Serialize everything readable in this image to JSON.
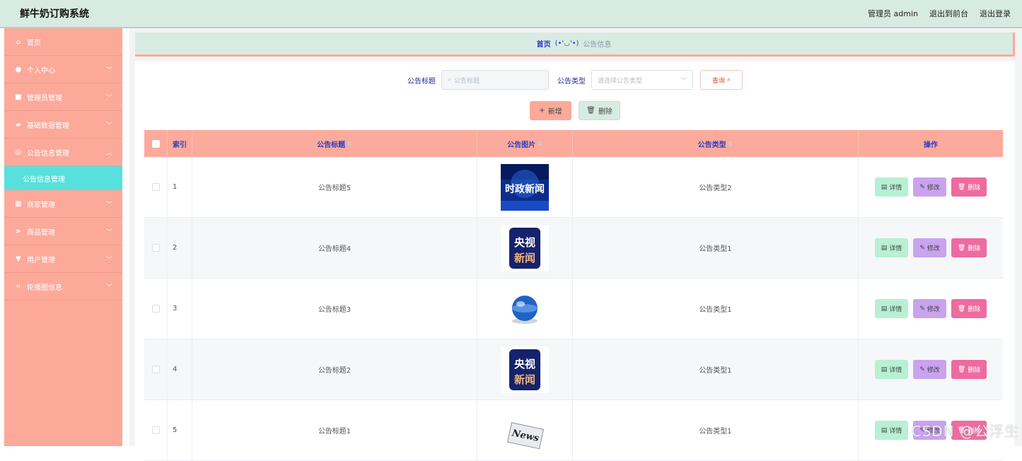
{
  "app": {
    "title": "鲜牛奶订购系统"
  },
  "top_actions": {
    "user": "管理员 admin",
    "front": "退出到前台",
    "logout": "退出登录"
  },
  "sidebar": {
    "items": [
      {
        "label": "首页",
        "icon": "home-icon"
      },
      {
        "label": "个人中心",
        "icon": "user-icon"
      },
      {
        "label": "管理员管理",
        "icon": "admin-icon"
      },
      {
        "label": "基础数据管理",
        "icon": "data-icon"
      },
      {
        "label": "公告信息管理",
        "icon": "notice-icon"
      },
      {
        "label": "商家管理",
        "icon": "grid-icon"
      },
      {
        "label": "商品管理",
        "icon": "send-icon"
      },
      {
        "label": "用户管理",
        "icon": "users-icon"
      },
      {
        "label": "轮播图信息",
        "icon": "crop-icon"
      }
    ],
    "sub_active": "公告信息管理"
  },
  "breadcrumb": {
    "home": "首页",
    "separator": "(•'◡'•)",
    "current": "公告信息"
  },
  "search": {
    "title_label": "公告标题",
    "title_placeholder": "公告标题",
    "type_label": "公告类型",
    "type_placeholder": "请选择公告类型",
    "query_label": "查询"
  },
  "actions": {
    "add_label": "新增",
    "delete_label": "删除"
  },
  "table": {
    "headers": {
      "index": "索引",
      "title": "公告标题",
      "image": "公告图片",
      "type": "公告类型",
      "ops": "操作"
    },
    "rows": [
      {
        "index": "1",
        "title": "公告标题5",
        "type": "公告类型2",
        "image": "时政新闻"
      },
      {
        "index": "2",
        "title": "公告标题4",
        "type": "公告类型1",
        "image": "央视新闻"
      },
      {
        "index": "3",
        "title": "公告标题3",
        "type": "公告类型1",
        "image": "globe"
      },
      {
        "index": "4",
        "title": "公告标题2",
        "type": "公告类型1",
        "image": "央视新闻"
      },
      {
        "index": "5",
        "title": "公告标题1",
        "type": "公告类型1",
        "image": "News"
      }
    ],
    "op_labels": {
      "detail": "详情",
      "edit": "修改",
      "delete": "删除"
    }
  },
  "colors": {
    "accent": "#fca99a",
    "header_bg": "#d7ebe2",
    "active_sub": "#58e1dc"
  },
  "watermark": "CSDN @公浮生"
}
